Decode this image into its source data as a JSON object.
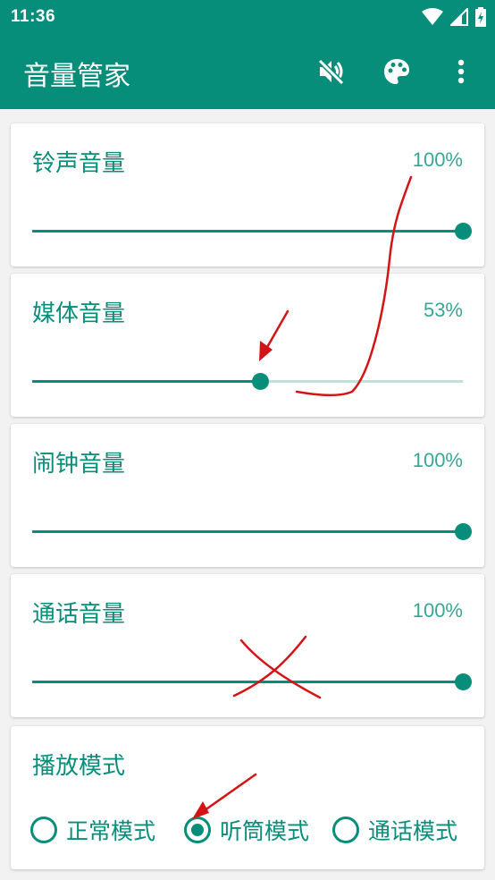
{
  "status_bar": {
    "time": "11:36",
    "icons": [
      "wifi-icon",
      "signal-icon",
      "battery-charging-icon"
    ]
  },
  "app_bar": {
    "title": "音量管家",
    "actions": [
      "mute-icon",
      "palette-icon",
      "more-vert-icon"
    ]
  },
  "volume_cards": [
    {
      "label": "铃声音量",
      "percent_text": "100%",
      "value": 1.0
    },
    {
      "label": "媒体音量",
      "percent_text": "53%",
      "value": 0.53
    },
    {
      "label": "闹钟音量",
      "percent_text": "100%",
      "value": 1.0
    },
    {
      "label": "通话音量",
      "percent_text": "100%",
      "value": 1.0
    }
  ],
  "play_mode": {
    "label": "播放模式",
    "options": [
      "正常模式",
      "听筒模式",
      "通话模式"
    ],
    "selected": "听筒模式"
  },
  "colors": {
    "primary": "#078e7a",
    "track_inactive": "#bfe2dd",
    "annotation": "#d41414"
  }
}
